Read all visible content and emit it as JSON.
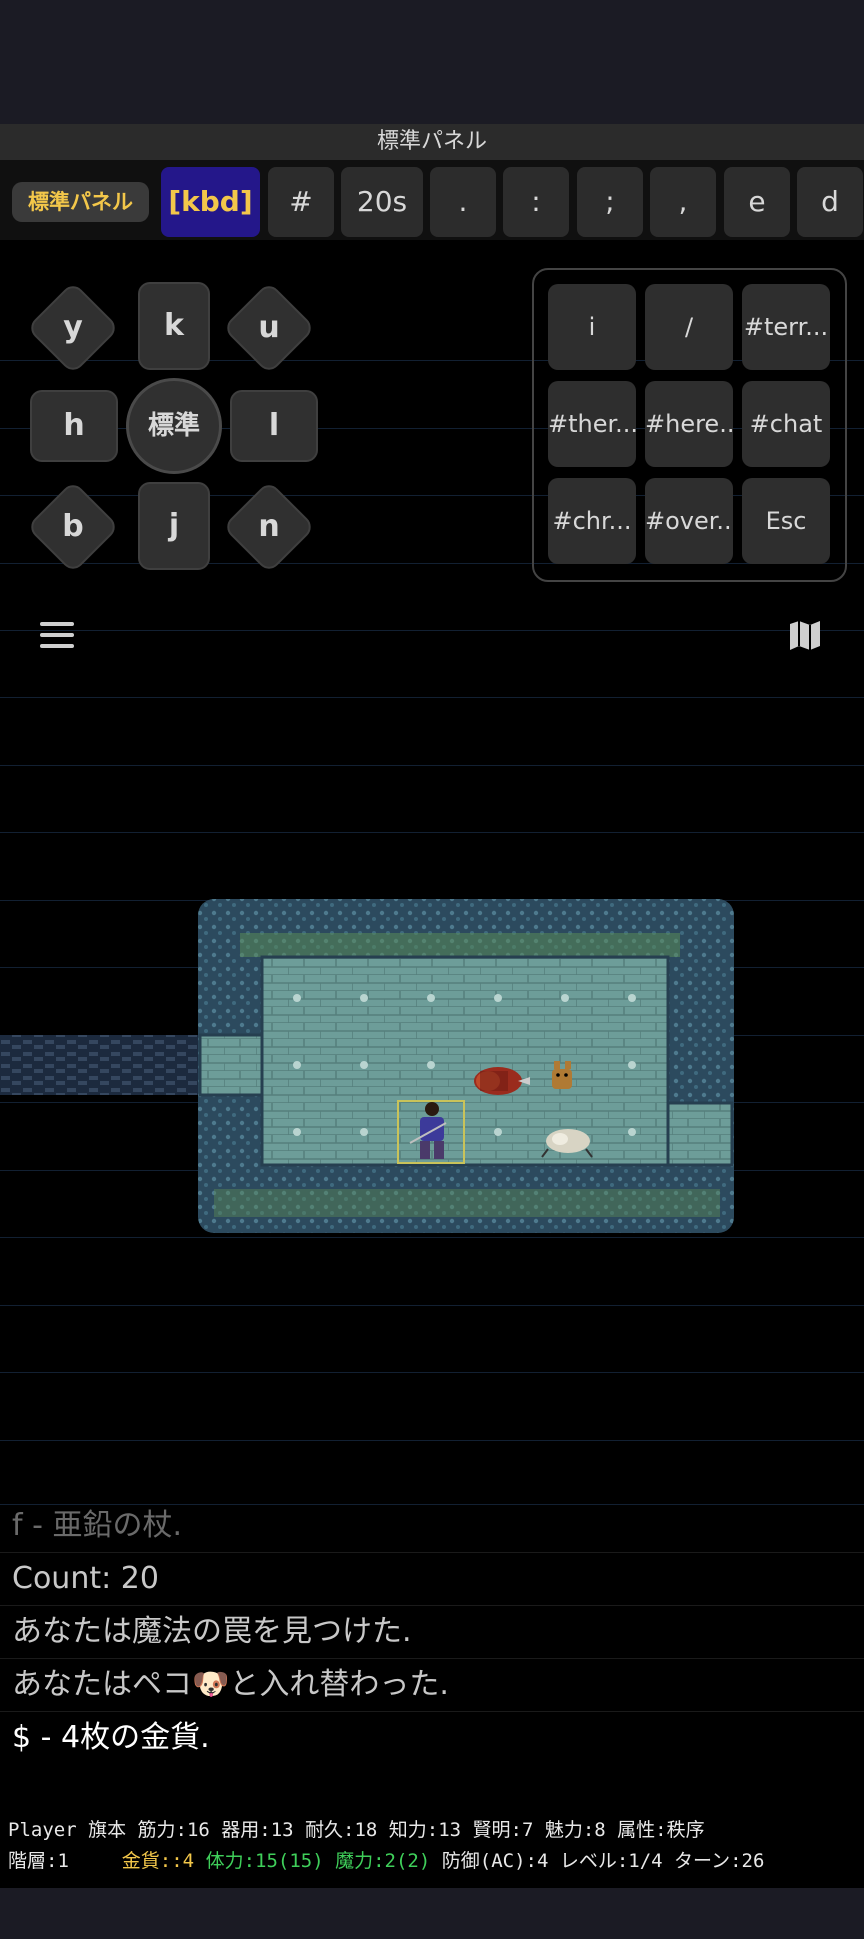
{
  "panel_title": "標準パネル",
  "key_row": {
    "mode_badge": "標準パネル",
    "keys": [
      "[kbd]",
      "#",
      "20s",
      ".",
      ":",
      ";",
      ",",
      "e",
      "d"
    ]
  },
  "dpad": {
    "y": "y",
    "k": "k",
    "u": "u",
    "h": "h",
    "center": "標準",
    "l": "l",
    "b": "b",
    "j": "j",
    "n": "n"
  },
  "quick_panel": {
    "keys": [
      "i",
      "/",
      "#terr...",
      "#ther...",
      "#here...",
      "#chat",
      "#chr...",
      "#over...",
      "Esc"
    ]
  },
  "icons": {
    "menu": "hamburger-menu-icon",
    "map": "map-icon"
  },
  "messages": [
    "f - 亜鉛の杖.",
    "Count: 20",
    "あなたは魔法の罠を見つけた.",
    "あなたはペコ🐶と入れ替わった.",
    "$ - 4枚の金貨."
  ],
  "status": {
    "line1": "Player 旗本 筋力:16 器用:13 耐久:18 知力:13 賢明:7 魅力:8 属性:秩序",
    "depth": "階層:1",
    "gold": "金貨::4",
    "hp": "体力:15(15)",
    "pw": "魔力:2(2)",
    "rest": "防御(AC):4 レベル:1/4 ターン:26"
  },
  "colors": {
    "gold": "#f3c74a",
    "hp": "#3fcf5a",
    "pw": "#3fcf5a",
    "kbd_bg": "#24178a",
    "floor": "#6a9a96",
    "wall": "#3f6579"
  }
}
